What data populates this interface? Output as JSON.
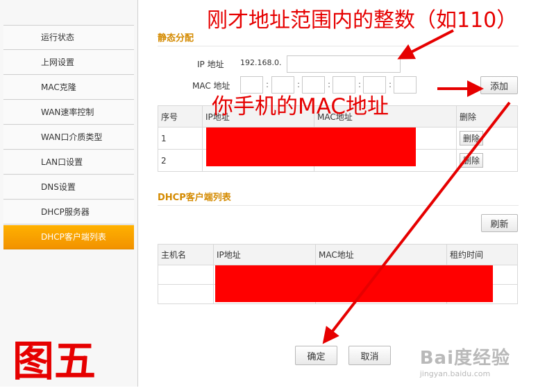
{
  "sidebar": {
    "items": [
      {
        "label": "运行状态"
      },
      {
        "label": "上网设置"
      },
      {
        "label": "MAC克隆"
      },
      {
        "label": "WAN速率控制"
      },
      {
        "label": "WAN口介质类型"
      },
      {
        "label": "LAN口设置"
      },
      {
        "label": "DNS设置"
      },
      {
        "label": "DHCP服务器"
      },
      {
        "label": "DHCP客户端列表",
        "active": true
      }
    ]
  },
  "static_alloc": {
    "title": "静态分配",
    "ip_label": "IP 地址",
    "ip_prefix": "192.168.0.",
    "ip_value": "",
    "mac_label": "MAC 地址",
    "mac_sep": ":",
    "add_button": "添加",
    "table": {
      "headers": [
        "序号",
        "IP地址",
        "MAC地址",
        "删除"
      ],
      "rows": [
        {
          "index": "1",
          "delete": "删除"
        },
        {
          "index": "2",
          "delete": "删除"
        }
      ]
    }
  },
  "dhcp_list": {
    "title": "DHCP客户端列表",
    "refresh_button": "刷新",
    "table": {
      "headers": [
        "主机名",
        "IP地址",
        "MAC地址",
        "租约时间"
      ]
    }
  },
  "footer": {
    "confirm_button": "确定",
    "cancel_button": "取消"
  },
  "annotations": {
    "ip_note": "刚才地址范围内的整数（如110）",
    "mac_note": "你手机的MAC地址",
    "figure_label": "图五",
    "color": "#e60000"
  },
  "watermark": {
    "brand": "Bai度经验",
    "url": "jingyan.baidu.com"
  },
  "colors": {
    "accent": "#f29200",
    "section_title": "#d48a00",
    "redaction": "#ff0000"
  }
}
